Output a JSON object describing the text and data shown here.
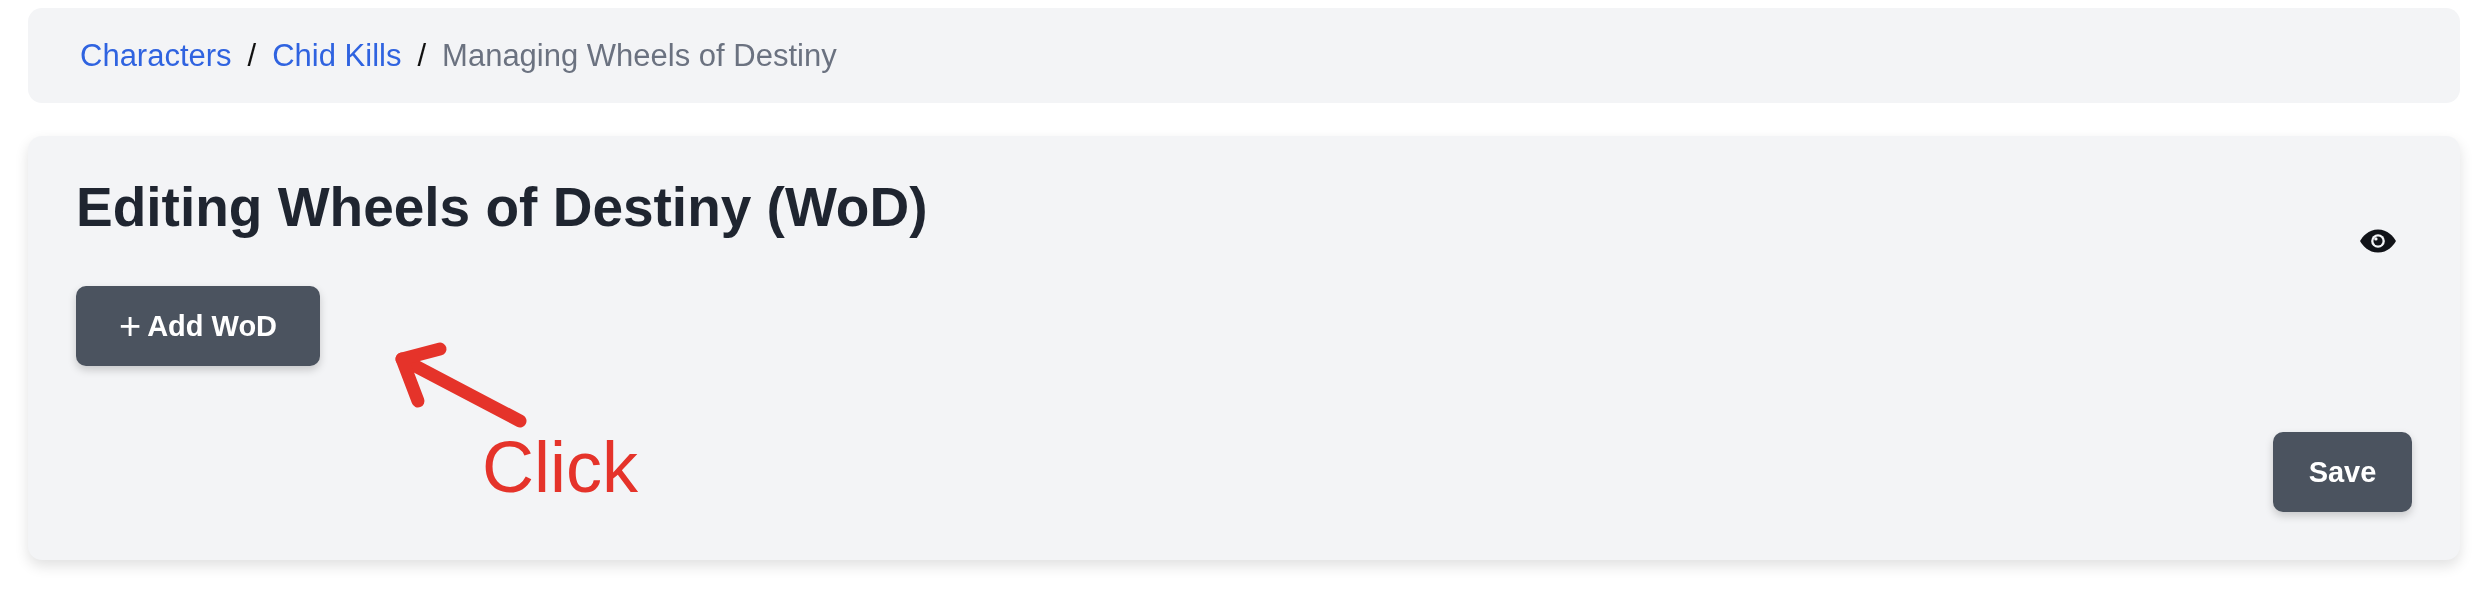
{
  "breadcrumb": [
    {
      "label": "Characters",
      "kind": "link"
    },
    {
      "label": "Chid Kills",
      "kind": "link"
    },
    {
      "label": "Managing Wheels of Destiny",
      "kind": "current"
    }
  ],
  "separator": "/",
  "card": {
    "title": "Editing Wheels of Destiny (WoD)",
    "add_button": {
      "icon": "+",
      "label": "Add WoD"
    },
    "save_button": "Save"
  },
  "annotation": {
    "text": "Click"
  }
}
